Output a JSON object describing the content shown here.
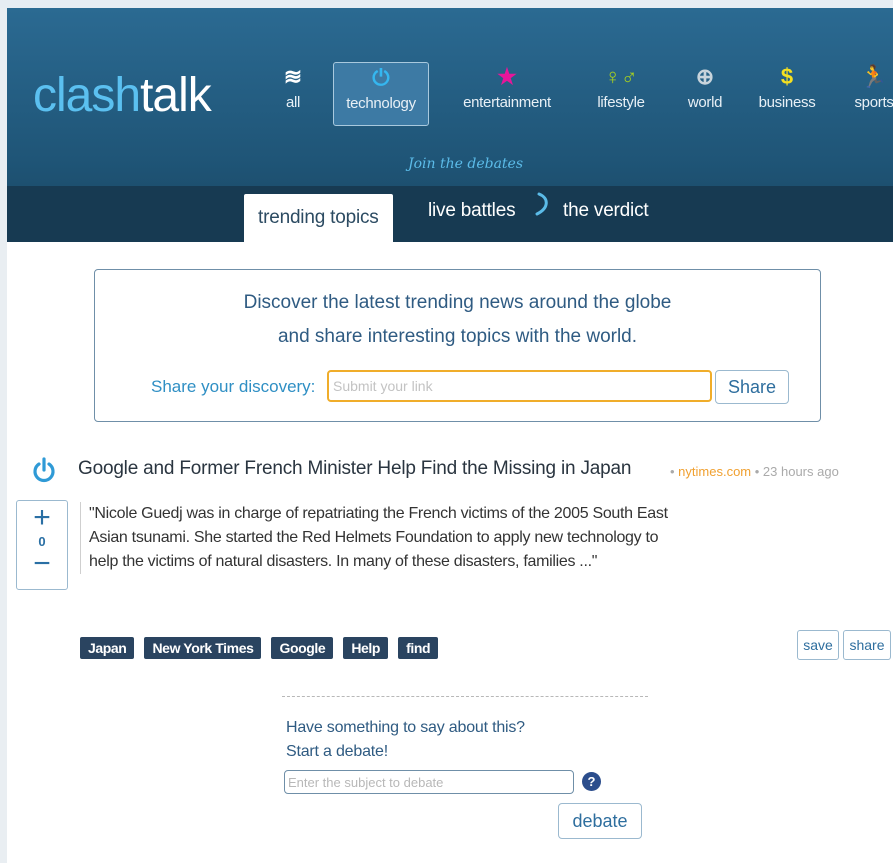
{
  "logo": {
    "part1": "clash",
    "part2": "talk"
  },
  "categories": [
    {
      "label": "all",
      "icon": "≋",
      "color": "#ffffff"
    },
    {
      "label": "technology",
      "icon": "⏻",
      "color": "#35b7f0"
    },
    {
      "label": "entertainment",
      "icon": "★",
      "color": "#e6169a"
    },
    {
      "label": "lifestyle",
      "icon": "♀♂",
      "color": "#a8d020"
    },
    {
      "label": "world",
      "icon": "⊕",
      "color": "#c8d4dc"
    },
    {
      "label": "business",
      "icon": "$",
      "color": "#f5e020"
    },
    {
      "label": "sports",
      "icon": "🏃",
      "color": "#44c040"
    }
  ],
  "tagline": "Join the debates",
  "tabs": {
    "trending": "trending topics",
    "live": "live battles",
    "verdict": "the verdict"
  },
  "discover": {
    "line1": "Discover the latest trending news around the globe",
    "line2": "and share interesting topics with the world.",
    "share_label": "Share your discovery:",
    "input_placeholder": "Submit your link",
    "share_button": "Share"
  },
  "article": {
    "title": "Google and Former French Minister Help Find the Missing in Japan",
    "source": "nytimes.com",
    "time": "23 hours ago",
    "votes": "0",
    "excerpt": "\"Nicole Guedj was in charge of repatriating the French victims of the 2005 South East Asian tsunami. She started the Red Helmets Foundation to apply new technology to help the victims of natural disasters. In many of these disasters, families ...\"",
    "tags": [
      "Japan",
      "New York Times",
      "Google",
      "Help",
      "find"
    ],
    "save_label": "save",
    "share_label": "share"
  },
  "debate": {
    "line1": "Have something to say about this?",
    "line2": "Start a debate!",
    "input_placeholder": "Enter the subject to debate",
    "help": "?",
    "button": "debate"
  },
  "colors": {
    "accent": "#2e6e9e",
    "header": "#1f5577",
    "tabbar": "#173a52",
    "tag": "#2a4460",
    "highlight": "#f0ad2a"
  }
}
